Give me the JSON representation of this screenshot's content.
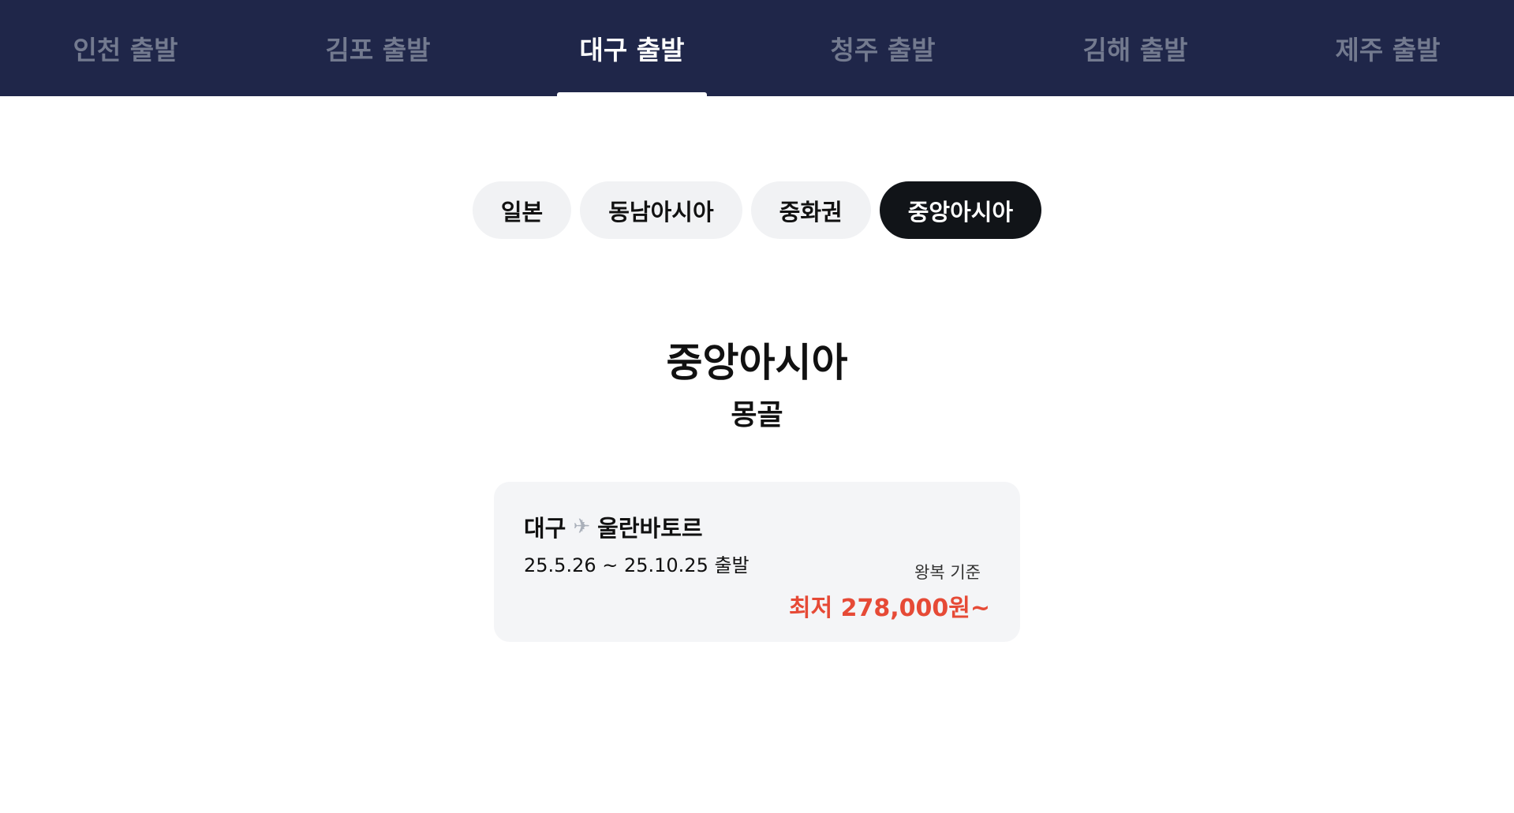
{
  "departure_tabs": [
    {
      "label": "인천 출발",
      "active": false
    },
    {
      "label": "김포 출발",
      "active": false
    },
    {
      "label": "대구 출발",
      "active": true
    },
    {
      "label": "청주 출발",
      "active": false
    },
    {
      "label": "김해 출발",
      "active": false
    },
    {
      "label": "제주 출발",
      "active": false
    }
  ],
  "region_pills": [
    {
      "label": "일본",
      "active": false
    },
    {
      "label": "동남아시아",
      "active": false
    },
    {
      "label": "중화권",
      "active": false
    },
    {
      "label": "중앙아시아",
      "active": true
    }
  ],
  "section": {
    "title": "중앙아시아",
    "subtitle": "몽골"
  },
  "route_card": {
    "origin": "대구",
    "icon": "airplane-icon",
    "destination": "울란바토르",
    "dates": "25.5.26 ~ 25.10.25 출발",
    "fare_basis": "왕복 기준",
    "price": "최저 278,000원~"
  },
  "colors": {
    "nav_background": "#1f2649",
    "nav_inactive_text": "#737a8f",
    "pill_background": "#f1f2f4",
    "pill_active_background": "#111418",
    "card_background": "#f4f5f7",
    "price_accent": "#e64a36"
  }
}
